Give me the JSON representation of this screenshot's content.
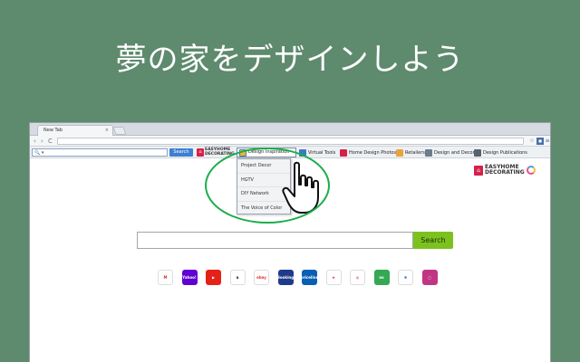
{
  "headline": "夢の家をデザインしよう",
  "browser": {
    "tab_title": "New Tab",
    "tab_close": "×",
    "nav": {
      "back": "‹",
      "forward": "›",
      "reload": "C"
    }
  },
  "toolbar": {
    "search_placeholder": "🔍 ▾",
    "search_button": "Search",
    "logo_line1": "EASYHOME",
    "logo_line2": "DECORATING",
    "design_inspiration": "Design Inspiration",
    "virtual_tools": "Virtual Tools",
    "home_design_photos": "Home Design Photos",
    "retailers": "Retailers",
    "design_and_decor": "Design and Decor",
    "design_publications": "Design Publications"
  },
  "dropdown": {
    "items": [
      "Project Decor",
      "HGTV",
      "DIY Network",
      "The Voice of Color"
    ]
  },
  "page": {
    "logo_line1": "EASYHOME",
    "logo_line2": "DECORATING",
    "search_button": "Search",
    "shortcuts": [
      {
        "name": "gmail",
        "label": "M",
        "color": "#ffffff",
        "text": "#d93025"
      },
      {
        "name": "yahoo",
        "label": "Yahoo!",
        "color": "#5f01d1",
        "text": "#ffffff"
      },
      {
        "name": "youtube",
        "label": "▶",
        "color": "#e62117",
        "text": "#ffffff"
      },
      {
        "name": "amazon",
        "label": "a",
        "color": "#ffffff",
        "text": "#111111"
      },
      {
        "name": "ebay",
        "label": "ebay",
        "color": "#ffffff",
        "text": "#e53238"
      },
      {
        "name": "booking",
        "label": "Booking",
        "color": "#1e3a8a",
        "text": "#ffffff"
      },
      {
        "name": "priceline",
        "label": "priceline",
        "color": "#0a5fb4",
        "text": "#ffffff"
      },
      {
        "name": "macys",
        "label": "★",
        "color": "#ffffff",
        "text": "#e21a2c"
      },
      {
        "name": "target",
        "label": "◎",
        "color": "#ffffff",
        "text": "#cc0000"
      },
      {
        "name": "tripadvisor",
        "label": "oo",
        "color": "#34a853",
        "text": "#ffffff"
      },
      {
        "name": "walmart",
        "label": "✱",
        "color": "#ffffff",
        "text": "#1a75cf"
      },
      {
        "name": "instagram",
        "label": "◻",
        "color": "#c13584",
        "text": "#ffffff"
      }
    ]
  }
}
